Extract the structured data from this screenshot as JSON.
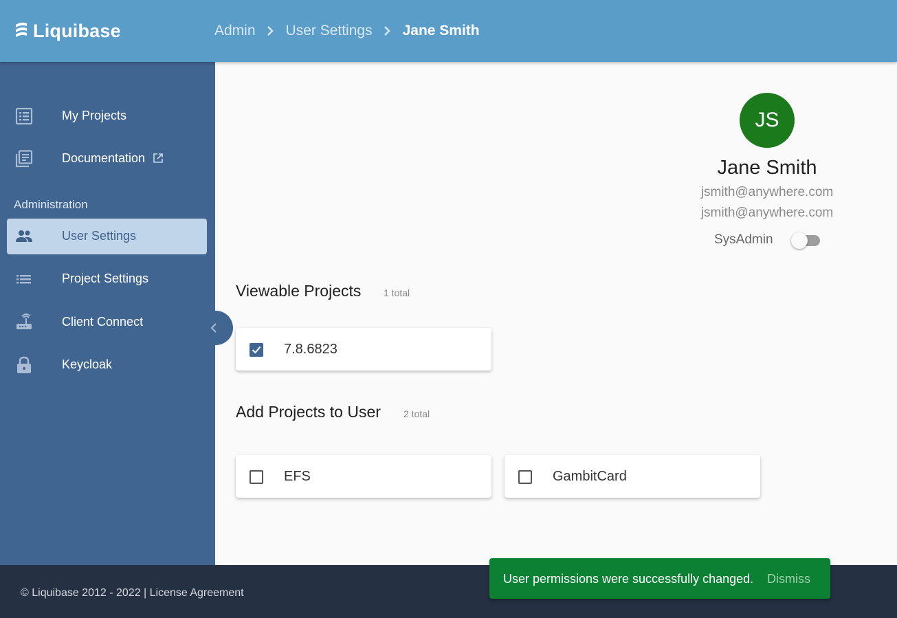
{
  "header": {
    "logo_text": "Liquibase",
    "breadcrumb": [
      "Admin",
      "User Settings",
      "Jane Smith"
    ]
  },
  "sidebar": {
    "items": [
      {
        "label": "My Projects",
        "icon": "list-alt-icon"
      },
      {
        "label": "Documentation",
        "icon": "library-books-icon",
        "external": true
      }
    ],
    "section_label": "Administration",
    "admin_items": [
      {
        "label": "User Settings",
        "icon": "people-icon",
        "active": true
      },
      {
        "label": "Project Settings",
        "icon": "list-icon"
      },
      {
        "label": "Client Connect",
        "icon": "router-icon"
      },
      {
        "label": "Keycloak",
        "icon": "lock-icon"
      }
    ]
  },
  "user": {
    "initials": "JS",
    "name": "Jane Smith",
    "email": "jsmith@anywhere.com",
    "username": "jsmith@anywhere.com",
    "sysadmin_label": "SysAdmin",
    "sysadmin_enabled": false,
    "avatar_color": "#1a7a1c"
  },
  "viewable": {
    "title": "Viewable Projects",
    "count": "1 total",
    "projects": [
      {
        "name": "7.8.6823",
        "checked": true
      }
    ]
  },
  "add": {
    "title": "Add Projects to User",
    "count": "2 total",
    "projects": [
      {
        "name": "EFS",
        "checked": false
      },
      {
        "name": "GambitCard",
        "checked": false
      }
    ]
  },
  "footer": {
    "text": "© Liquibase 2012 - 2022 | License Agreement"
  },
  "toast": {
    "message": "User permissions were successfully changed.",
    "dismiss": "Dismiss"
  },
  "colors": {
    "header": "#5b9dc9",
    "sidebar": "#406591",
    "footer": "#253042",
    "toast": "#0c8134"
  }
}
